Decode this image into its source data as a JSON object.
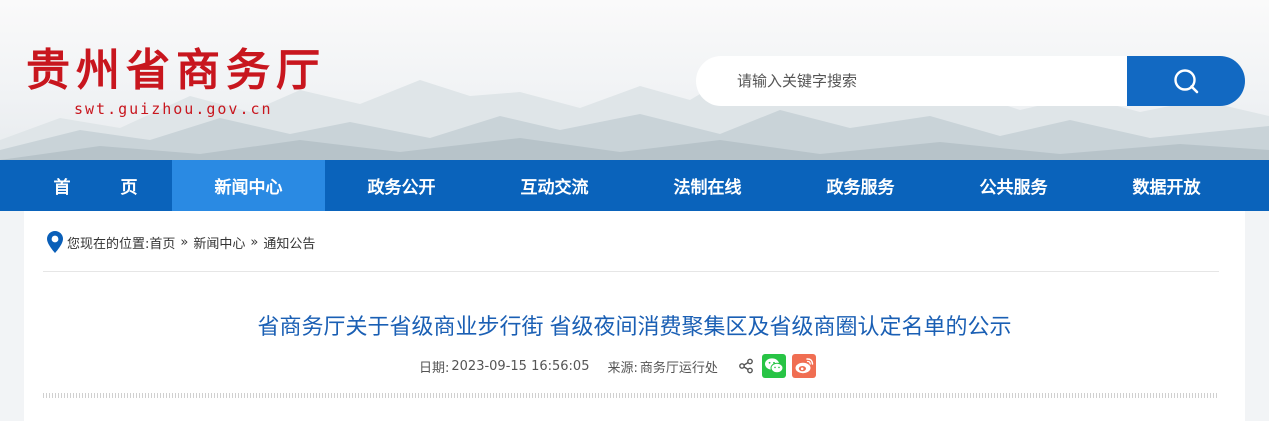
{
  "header": {
    "site_name": "贵州省商务厅",
    "site_domain": "swt.guizhou.gov.cn",
    "search": {
      "placeholder": "请输入关键字搜索"
    }
  },
  "nav": {
    "items": [
      {
        "label": "首 页",
        "active": false
      },
      {
        "label": "新闻中心",
        "active": true
      },
      {
        "label": "政务公开",
        "active": false
      },
      {
        "label": "互动交流",
        "active": false
      },
      {
        "label": "法制在线",
        "active": false
      },
      {
        "label": "政务服务",
        "active": false
      },
      {
        "label": "公共服务",
        "active": false
      },
      {
        "label": "数据开放",
        "active": false
      }
    ]
  },
  "breadcrumb": {
    "prefix": "您现在的位置:",
    "items": [
      "首页",
      "新闻中心",
      "通知公告"
    ],
    "separator": "»"
  },
  "article": {
    "title": "省商务厅关于省级商业步行街 省级夜间消费聚集区及省级商圈认定名单的公示",
    "date_label": "日期:",
    "date": "2023-09-15 16:56:05",
    "source_label": "来源:",
    "source": "商务厅运行处"
  },
  "icons": {
    "search": "search-icon",
    "location": "location-pin-icon",
    "share": "share-icon",
    "wechat": "wechat-icon",
    "weibo": "weibo-icon"
  },
  "colors": {
    "brand_red": "#c8161e",
    "nav_blue": "#0a63bb",
    "nav_active": "#2a8ae3",
    "title_blue": "#1a5fb4",
    "wechat_green": "#28c445",
    "weibo_orange": "#f06e52"
  }
}
